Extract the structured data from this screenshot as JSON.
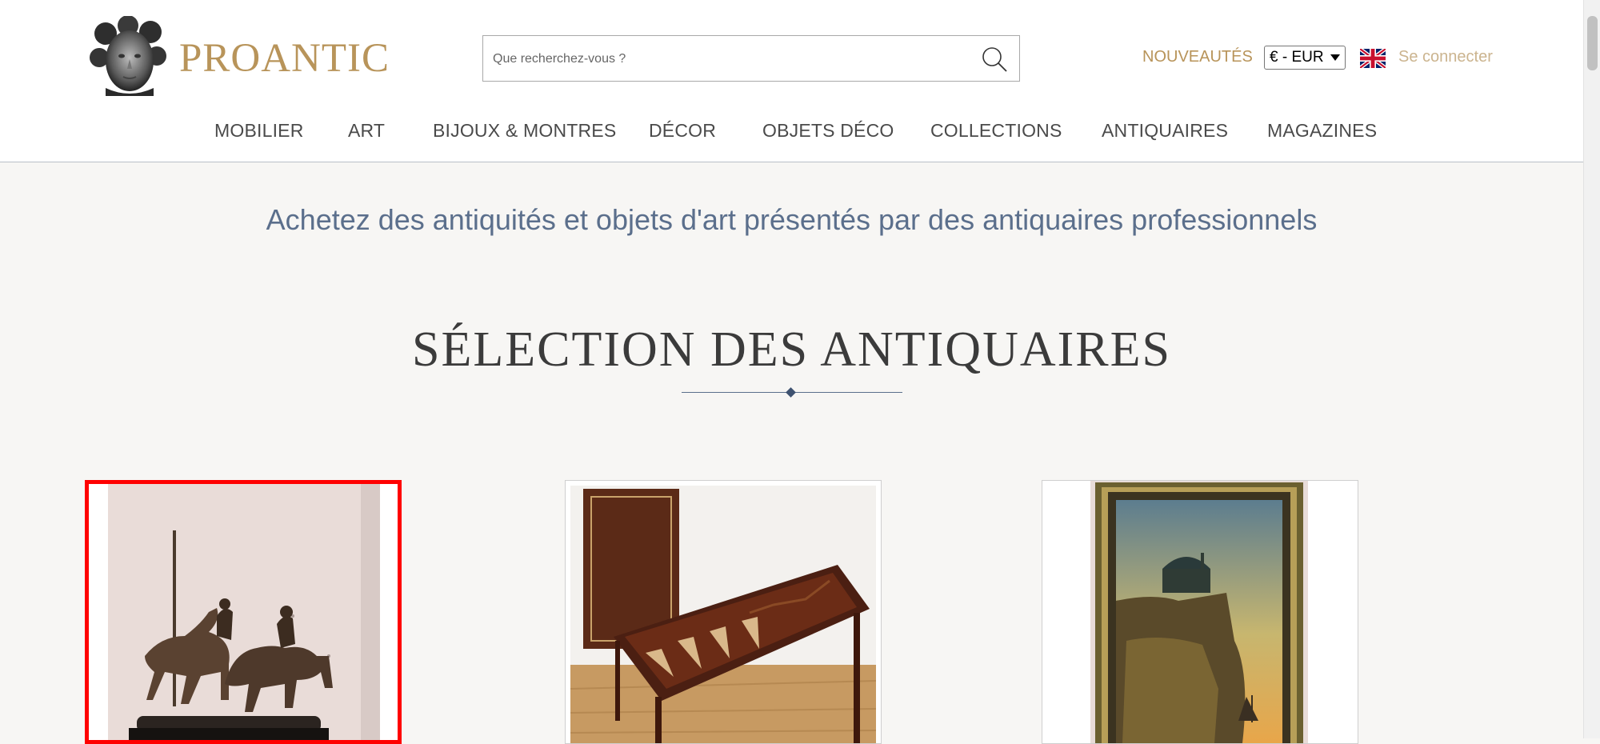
{
  "brand": {
    "name": "PROANTIC"
  },
  "search": {
    "placeholder": "Que recherchez-vous ?"
  },
  "header": {
    "new_label": "NOUVEAUTÉS",
    "currency": "€ - EUR",
    "login_label": "Se connecter"
  },
  "nav": {
    "items": [
      "MOBILIER",
      "ART",
      "BIJOUX & MONTRES",
      "DÉCOR",
      "OBJETS DÉCO",
      "COLLECTIONS",
      "ANTIQUAIRES",
      "MAGAZINES"
    ]
  },
  "main": {
    "tagline": "Achetez des antiquités et objets d'art présentés par des antiquaires professionnels",
    "section_title": "SÉLECTION DES ANTIQUAIRES"
  },
  "colors": {
    "brand": "#b8945a",
    "accent": "#5b6f8c",
    "selection": "#ff0000"
  }
}
